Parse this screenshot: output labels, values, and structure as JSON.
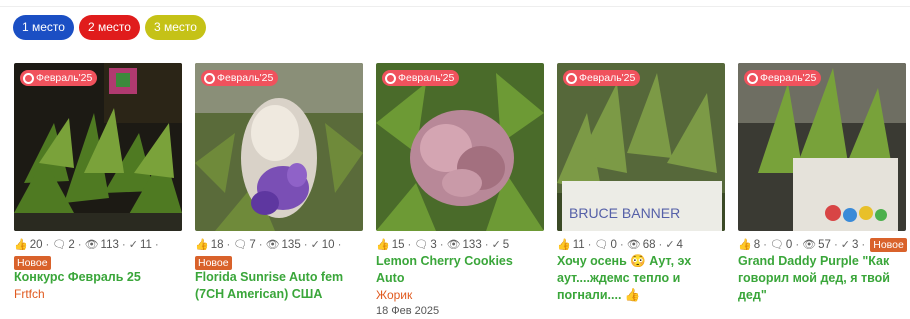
{
  "colors": {
    "place1": "#1b4fc4",
    "place2": "#e01c1c",
    "place3": "#c5c217",
    "month_badge": "#f0525d",
    "new_badge": "#d9622b",
    "title": "#3aa63a",
    "author": "#e05a1f"
  },
  "places": [
    "1 место",
    "2 место",
    "3 место"
  ],
  "cards": [
    {
      "month": "Февраль'25",
      "likes": "20",
      "comments": "2",
      "views": "113",
      "checks": "11",
      "badge": "Новое",
      "title": "Конкурс Февраль 25",
      "author": "Frtfch",
      "date": "",
      "image": "dark-plant"
    },
    {
      "month": "Февраль'25",
      "likes": "18",
      "comments": "7",
      "views": "135",
      "checks": "10",
      "badge": "Новое",
      "title": "Florida Sunrise Auto fem (7CH American) США",
      "author": "",
      "date": "",
      "image": "purple-bud"
    },
    {
      "month": "Февраль'25",
      "likes": "15",
      "comments": "3",
      "views": "133",
      "checks": "5",
      "badge": "",
      "title": "Lemon Cherry Cookies Auto",
      "author": "Жорик",
      "date": "18 Фев 2025",
      "image": "pink-bud"
    },
    {
      "month": "Февраль'25",
      "likes": "11",
      "comments": "0",
      "views": "68",
      "checks": "4",
      "badge": "",
      "title": "Хочу осень 😳 Аут, эх аут....ждемс тепло и погнали.... 👍",
      "author": "",
      "date": "",
      "image": "plant-card",
      "card_text": "BRUCE BANNER"
    },
    {
      "month": "Февраль'25",
      "likes": "8",
      "comments": "0",
      "views": "57",
      "checks": "3",
      "badge": "Новое",
      "title": "Grand Daddy Purple \"Как говорил мой дед, я твой дед\"",
      "author": "",
      "date": "",
      "image": "pot-plant"
    }
  ]
}
